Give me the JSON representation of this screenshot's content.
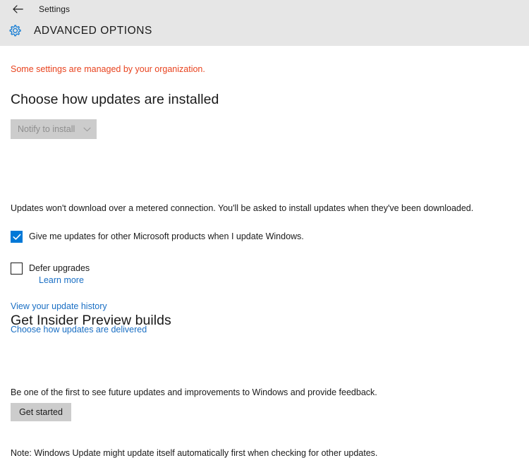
{
  "titlebar": {
    "back_icon": "back-arrow-icon",
    "app_title": "Settings"
  },
  "page_header": {
    "icon": "gear-icon",
    "title": "ADVANCED OPTIONS",
    "icon_color": "#1a7fd4",
    "band_color": "#e6e6e6"
  },
  "notices": {
    "managed_by_org": "Some settings are managed by your organization.",
    "managed_color": "#e8431f"
  },
  "updates_section": {
    "heading": "Choose how updates are installed",
    "dropdown": {
      "selected": "Notify to install",
      "chevron_icon": "chevron-down-icon",
      "disabled": true
    },
    "metered_note": "Updates won't download over a metered connection. You'll be asked to install updates when they've been downloaded.",
    "checkboxes": [
      {
        "label": "Give me updates for other Microsoft products when I update Windows.",
        "checked": true
      },
      {
        "label": "Defer upgrades",
        "checked": false,
        "sublink": "Learn more"
      }
    ],
    "links": [
      {
        "label": "View your update history"
      },
      {
        "label": "Choose how updates are delivered"
      }
    ]
  },
  "insider_section": {
    "heading": "Get Insider Preview builds",
    "description": "Be one of the first to see future updates and improvements to Windows and provide feedback.",
    "button_label": "Get started"
  },
  "footer": {
    "note": "Note: Windows Update might update itself automatically first when checking for other updates."
  },
  "theme": {
    "accent": "#0078d7",
    "link": "#1a6fc4",
    "control_bg": "#cccccc",
    "disabled_text": "#8e8e8e"
  }
}
